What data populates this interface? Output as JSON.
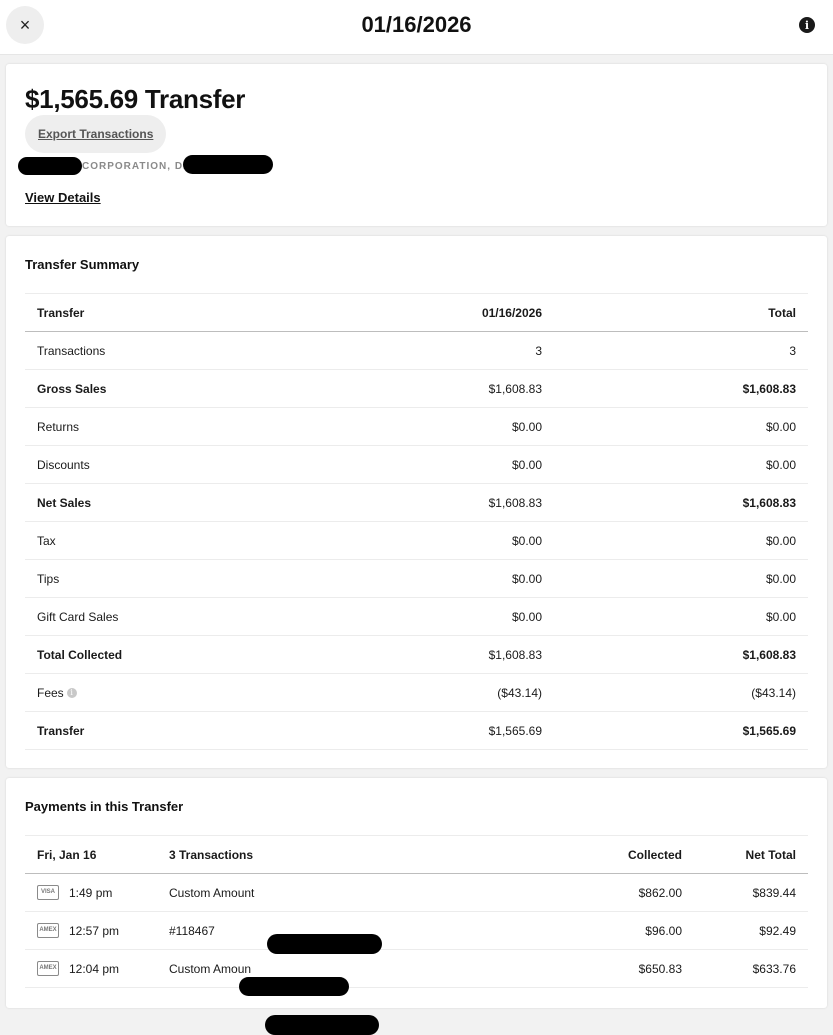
{
  "header": {
    "title": "01/16/2026",
    "close_icon": "×",
    "info_icon": "i"
  },
  "overview": {
    "amount_title": "$1,565.69 Transfer",
    "export_label": "Export Transactions",
    "merchant_text": "CORPORATION, DBA",
    "view_details_label": "View Details"
  },
  "summary": {
    "title": "Transfer Summary",
    "columns": [
      "Transfer",
      "01/16/2026",
      "Total"
    ],
    "rows": [
      {
        "label": "Transactions",
        "date": "3",
        "total": "3",
        "bold": false
      },
      {
        "label": "Gross Sales",
        "date": "$1,608.83",
        "total": "$1,608.83",
        "bold": true
      },
      {
        "label": "Returns",
        "date": "$0.00",
        "total": "$0.00",
        "bold": false
      },
      {
        "label": "Discounts",
        "date": "$0.00",
        "total": "$0.00",
        "bold": false
      },
      {
        "label": "Net Sales",
        "date": "$1,608.83",
        "total": "$1,608.83",
        "bold": true
      },
      {
        "label": "Tax",
        "date": "$0.00",
        "total": "$0.00",
        "bold": false
      },
      {
        "label": "Tips",
        "date": "$0.00",
        "total": "$0.00",
        "bold": false
      },
      {
        "label": "Gift Card Sales",
        "date": "$0.00",
        "total": "$0.00",
        "bold": false
      },
      {
        "label": "Total Collected",
        "date": "$1,608.83",
        "total": "$1,608.83",
        "bold": true
      },
      {
        "label": "Fees",
        "date": "($43.14)",
        "total": "($43.14)",
        "bold": false
      },
      {
        "label": "Transfer",
        "date": "$1,565.69",
        "total": "$1,565.69",
        "bold": true
      }
    ]
  },
  "payments": {
    "title": "Payments in this Transfer",
    "columns": [
      "Fri, Jan 16",
      "3 Transactions",
      "Collected",
      "Net Total"
    ],
    "rows": [
      {
        "card": "VISA",
        "time": "1:49 pm",
        "description": "Custom Amount",
        "collected": "$862.00",
        "net": "$839.44"
      },
      {
        "card": "AMEX",
        "time": "12:57 pm",
        "description": "#118467",
        "collected": "$96.00",
        "net": "$92.49"
      },
      {
        "card": "AMEX",
        "time": "12:04 pm",
        "description": "Custom Amoun",
        "collected": "$650.83",
        "net": "$633.76"
      }
    ]
  },
  "colors": {
    "background": "#f2f2f2",
    "card": "#ffffff",
    "text": "#1a1a1a",
    "muted": "#8a8a8a"
  }
}
